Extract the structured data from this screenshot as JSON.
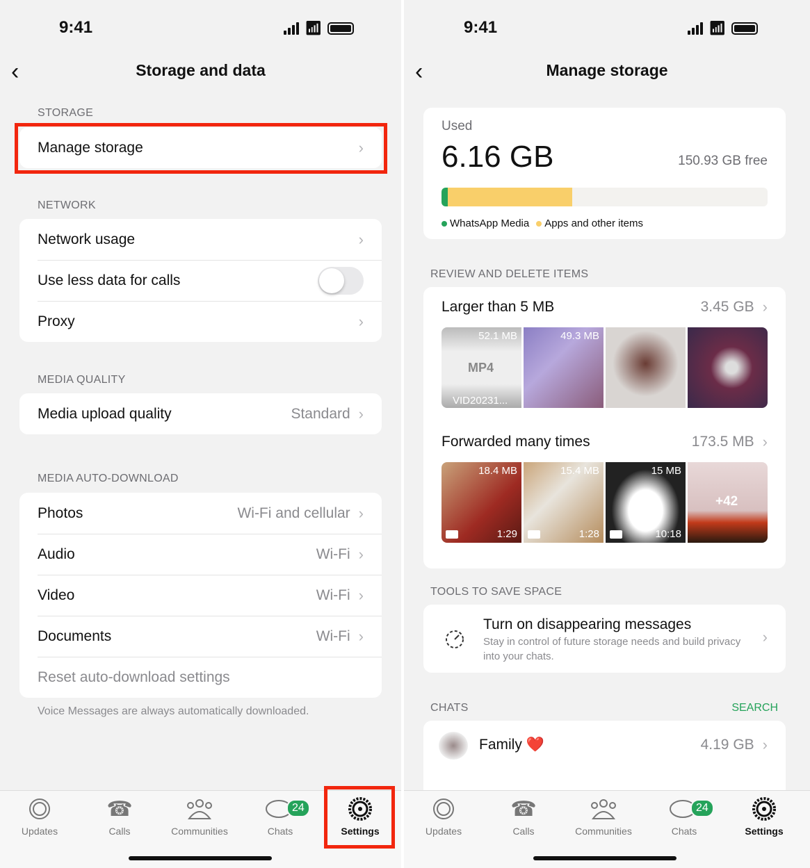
{
  "status": {
    "time": "9:41"
  },
  "left": {
    "title": "Storage and data",
    "sections": {
      "storage": "STORAGE",
      "network": "NETWORK",
      "media_quality": "MEDIA QUALITY",
      "auto_download": "MEDIA AUTO-DOWNLOAD"
    },
    "manage_storage": "Manage storage",
    "network": [
      {
        "label": "Network usage"
      },
      {
        "label": "Use less data for calls",
        "toggle": false
      },
      {
        "label": "Proxy"
      }
    ],
    "media_upload": {
      "label": "Media upload quality",
      "value": "Standard"
    },
    "auto_download": [
      {
        "label": "Photos",
        "value": "Wi-Fi and cellular"
      },
      {
        "label": "Audio",
        "value": "Wi-Fi"
      },
      {
        "label": "Video",
        "value": "Wi-Fi"
      },
      {
        "label": "Documents",
        "value": "Wi-Fi"
      }
    ],
    "reset": "Reset auto-download settings",
    "footer": "Voice Messages are always automatically downloaded."
  },
  "right": {
    "title": "Manage storage",
    "used_label": "Used",
    "used": "6.16 GB",
    "free": "150.93 GB free",
    "usage_bar": {
      "whatsapp_fraction": 0.02,
      "apps_fraction": 0.38,
      "whatsapp_color": "#25a35a",
      "apps_color": "#f9cf6a"
    },
    "legend": [
      "WhatsApp Media",
      "Apps and other items"
    ],
    "review_header": "REVIEW AND DELETE ITEMS",
    "larger": {
      "label": "Larger than 5 MB",
      "size": "3.45 GB",
      "thumbs": [
        {
          "size": "52.1 MB",
          "type": "MP4",
          "name": "VID20231..."
        },
        {
          "size": "49.3 MB"
        }
      ]
    },
    "forwarded": {
      "label": "Forwarded many times",
      "size": "173.5 MB",
      "thumbs": [
        {
          "size": "18.4 MB",
          "duration": "1:29"
        },
        {
          "size": "15.4 MB",
          "duration": "1:28"
        },
        {
          "size": "15 MB",
          "duration": "10:18"
        },
        {
          "more": "+42"
        }
      ]
    },
    "tools_header": "TOOLS TO SAVE SPACE",
    "disappearing": {
      "title": "Turn on disappearing messages",
      "desc": "Stay in control of future storage needs and build privacy into your chats."
    },
    "chats_header": "CHATS",
    "search": "SEARCH",
    "chats": [
      {
        "name": "Family ❤️",
        "size": "4.19 GB"
      }
    ]
  },
  "tabs": [
    {
      "label": "Updates"
    },
    {
      "label": "Calls"
    },
    {
      "label": "Communities"
    },
    {
      "label": "Chats",
      "badge": "24"
    },
    {
      "label": "Settings",
      "active": true
    }
  ],
  "accent": "#25a35a",
  "highlight": "#f2260e"
}
